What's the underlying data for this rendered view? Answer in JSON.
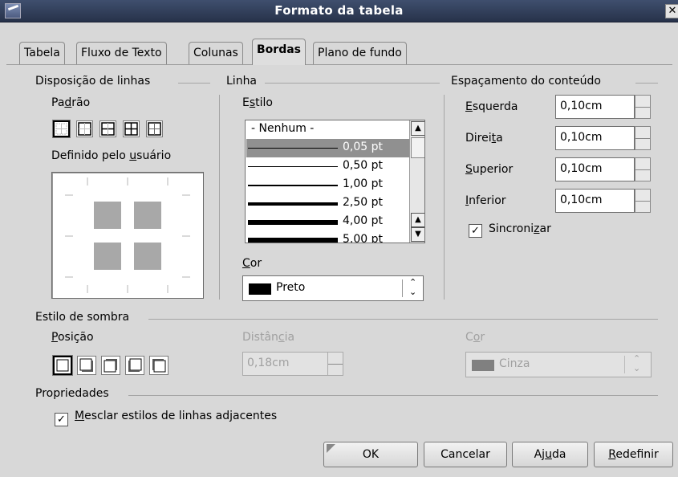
{
  "window": {
    "title": "Formato da tabela"
  },
  "tabs": [
    "Tabela",
    "Fluxo de Texto",
    "Colunas",
    "Bordas",
    "Plano de fundo"
  ],
  "active_tab": "Bordas",
  "line_arrangement": {
    "header": "Disposição de linhas",
    "default_label_pre": "Pa",
    "default_label_u": "d",
    "default_label_post": "rão",
    "user_label_pre": "Definido pelo ",
    "user_label_u": "u",
    "user_label_post": "suário"
  },
  "line": {
    "header": "Linha",
    "style_label_pre": "E",
    "style_label_u": "s",
    "style_label_post": "tilo",
    "styles": [
      {
        "label": "- Nenhum -",
        "weight": 0
      },
      {
        "label": "0,05 pt",
        "weight": 1,
        "selected": true
      },
      {
        "label": "0,50 pt",
        "weight": 1
      },
      {
        "label": "1,00 pt",
        "weight": 2
      },
      {
        "label": "2,50 pt",
        "weight": 4
      },
      {
        "label": "4,00 pt",
        "weight": 6
      },
      {
        "label": "5,00 pt",
        "weight": 7
      }
    ],
    "color_label_pre": "",
    "color_label_u": "C",
    "color_label_post": "or",
    "color_value": "Preto",
    "color_swatch": "#000000"
  },
  "spacing": {
    "header": "Espaçamento do conteúdo",
    "fields": [
      {
        "pre": "",
        "u": "E",
        "post": "squerda",
        "value": "0,10cm"
      },
      {
        "pre": "Direi",
        "u": "t",
        "post": "a",
        "value": "0,10cm"
      },
      {
        "pre": "",
        "u": "S",
        "post": "uperior",
        "value": "0,10cm"
      },
      {
        "pre": "",
        "u": "I",
        "post": "nferior",
        "value": "0,10cm"
      }
    ],
    "sync_pre": "Sincroni",
    "sync_u": "z",
    "sync_post": "ar",
    "sync_checked": true
  },
  "shadow": {
    "header": "Estilo de sombra",
    "position_pre": "",
    "position_u": "P",
    "position_post": "osição",
    "distance_pre": "Distân",
    "distance_u": "c",
    "distance_post": "ia",
    "distance_value": "0,18cm",
    "color_pre": "C",
    "color_u": "o",
    "color_post": "r",
    "color_value": "Cinza",
    "color_swatch": "#808080"
  },
  "properties": {
    "header": "Propriedades",
    "merge_pre": "",
    "merge_u": "M",
    "merge_post": "esclar estilos de linhas adjacentes",
    "merge_checked": true
  },
  "buttons": {
    "ok": "OK",
    "cancel": "Cancelar",
    "help_pre": "Aj",
    "help_u": "u",
    "help_post": "da",
    "reset_pre": "",
    "reset_u": "R",
    "reset_post": "edefinir"
  }
}
